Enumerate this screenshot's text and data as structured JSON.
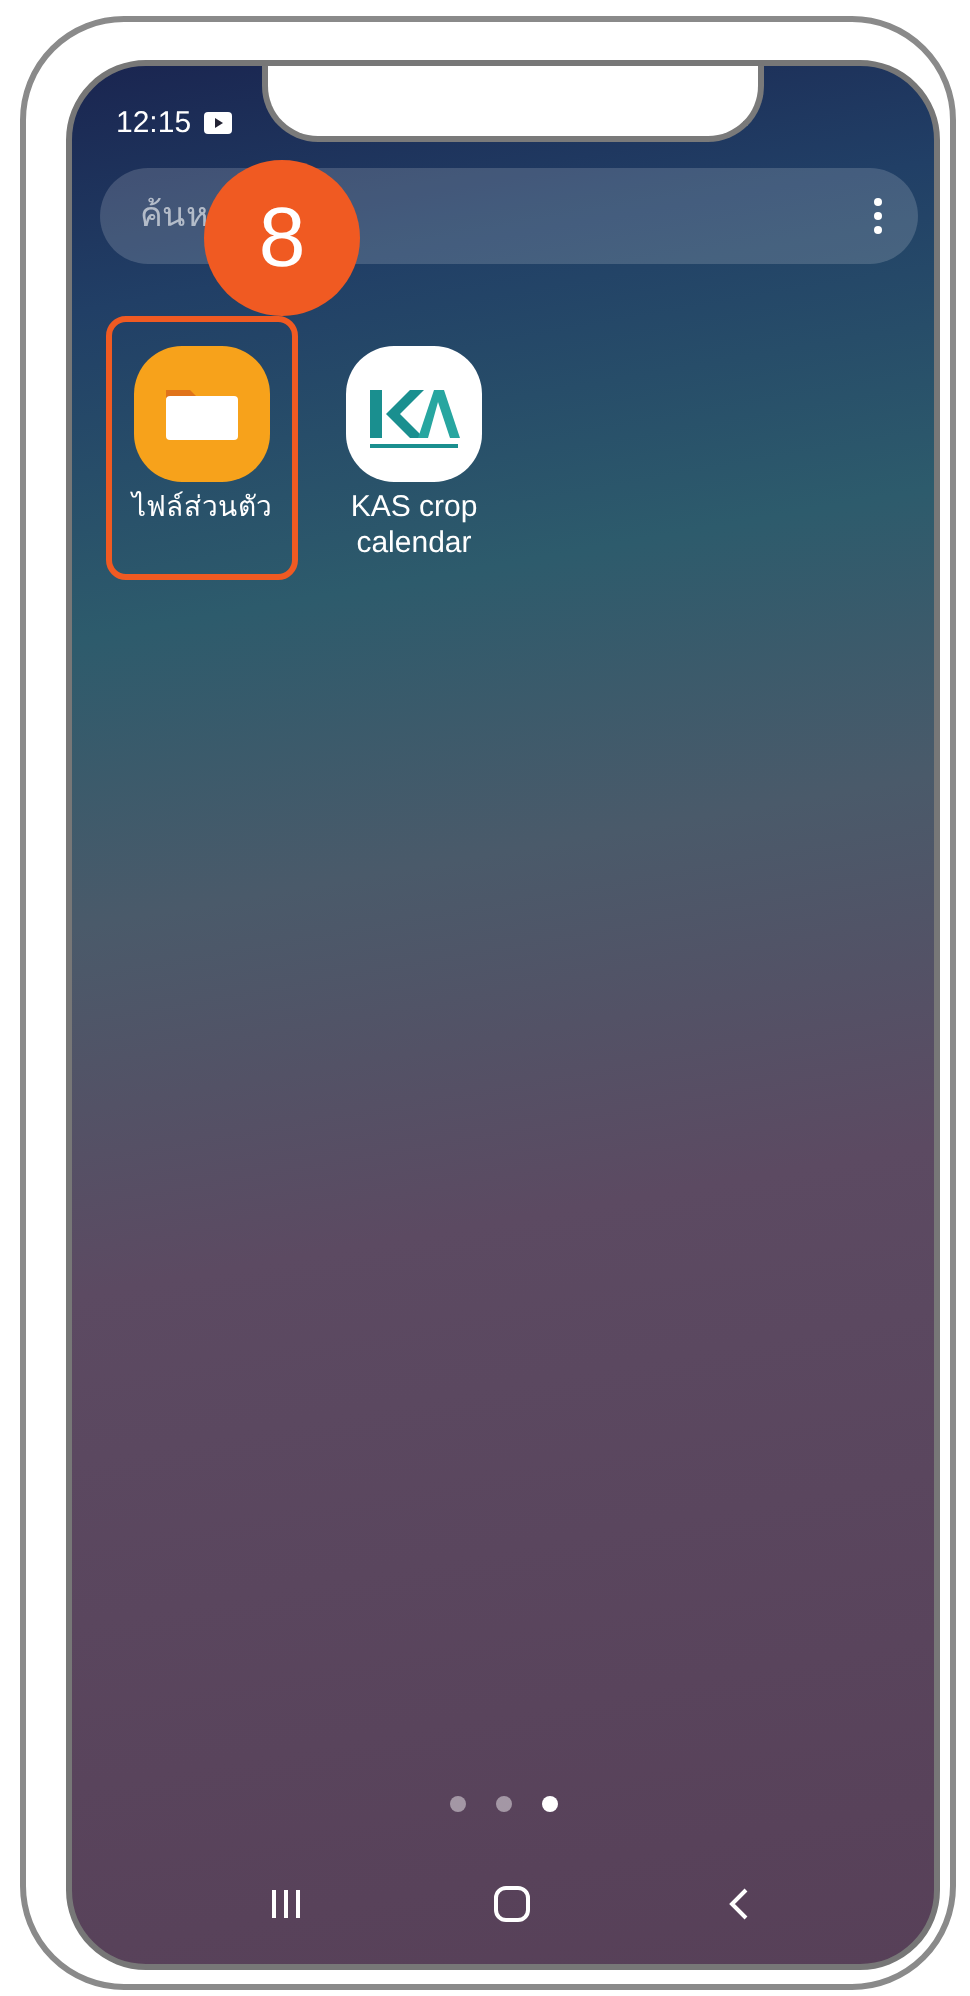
{
  "status_bar": {
    "time": "12:15"
  },
  "search": {
    "placeholder": "ค้นห"
  },
  "callout": {
    "number": "8"
  },
  "apps": [
    {
      "kind": "files",
      "label": "ไฟล์ส่วนตัว",
      "highlighted": true
    },
    {
      "kind": "kas",
      "label": "KAS crop calendar",
      "highlighted": false
    }
  ],
  "page_dots": [
    {
      "selected": false
    },
    {
      "selected": false
    },
    {
      "selected": true
    }
  ],
  "nav_buttons": [
    {
      "kind": "recents"
    },
    {
      "kind": "home"
    },
    {
      "kind": "back"
    }
  ]
}
